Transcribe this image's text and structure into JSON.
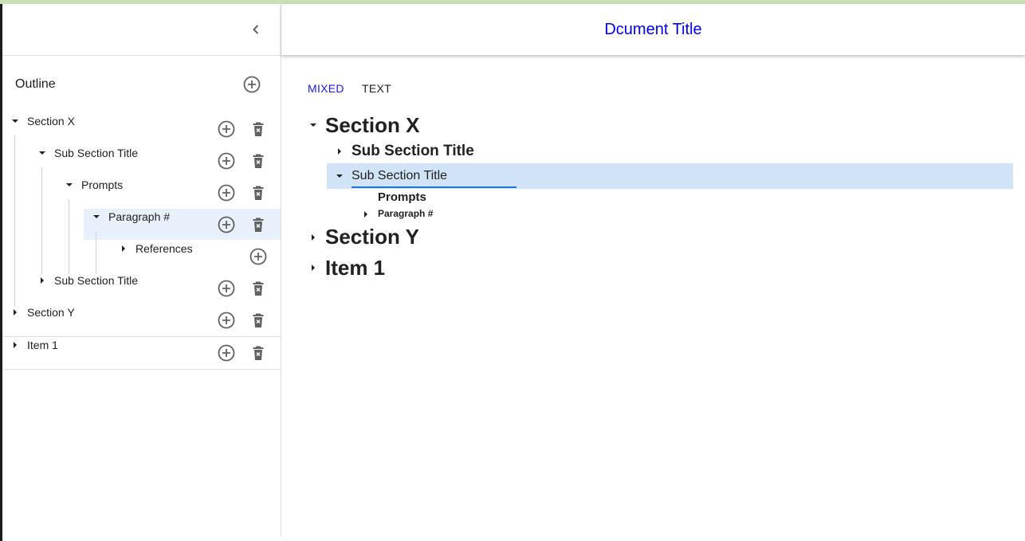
{
  "document": {
    "title": "Dcument Title"
  },
  "sidebar": {
    "collapse_icon": "chevron-left-icon",
    "outline_label": "Outline",
    "tree": [
      {
        "label": "Section X",
        "expanded": true,
        "depth": 0
      },
      {
        "label": "Sub Section Title",
        "expanded": true,
        "depth": 1
      },
      {
        "label": "Prompts",
        "expanded": true,
        "depth": 2
      },
      {
        "label": "Paragraph #",
        "expanded": true,
        "depth": 3,
        "selected": true
      },
      {
        "label": "References",
        "expanded": false,
        "depth": 4,
        "deletable": false
      },
      {
        "label": "Sub Section Title",
        "expanded": false,
        "depth": 1
      },
      {
        "label": "Section Y",
        "expanded": false,
        "depth": 0
      },
      {
        "label": "Item 1",
        "expanded": false,
        "depth": 0
      }
    ],
    "add_icon": "add-circle-icon",
    "delete_icon": "delete-forever-icon"
  },
  "main": {
    "tabs": [
      {
        "label": "MIXED",
        "active": true
      },
      {
        "label": "TEXT",
        "active": false
      }
    ],
    "content": {
      "section_x": "Section X",
      "sub_section_1": "Sub Section Title",
      "sub_section_2_value": "Sub Section Title",
      "prompts": "Prompts",
      "paragraph": "Paragraph #",
      "section_y": "Section Y",
      "item_1": "Item 1"
    }
  },
  "colors": {
    "accent": "#1a1aee",
    "selection": "#d1e3f6",
    "sidebar_selection": "#e8f0fb",
    "input_underline": "#1976d2"
  }
}
